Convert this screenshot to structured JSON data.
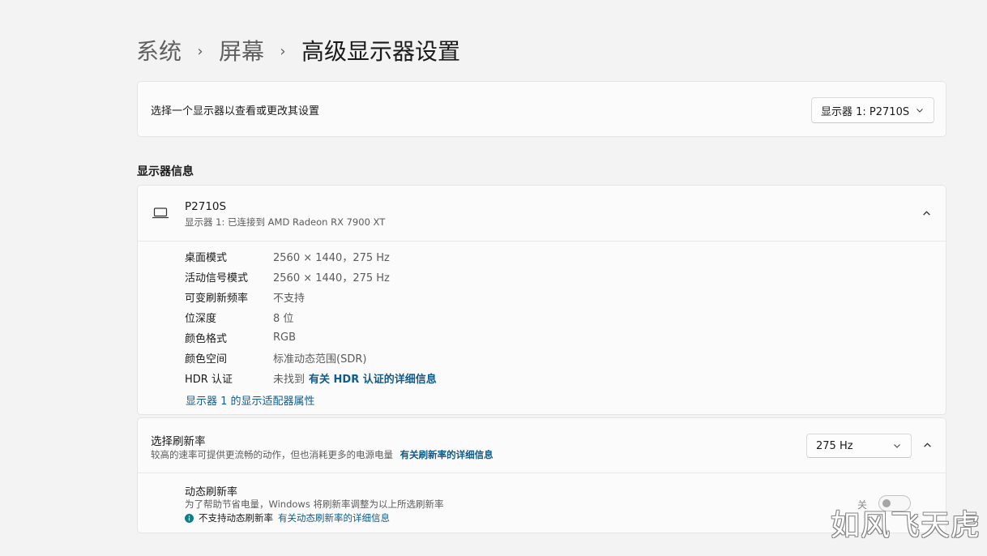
{
  "breadcrumb": {
    "items": [
      "系统",
      "屏幕",
      "高级显示器设置"
    ],
    "separator": "›"
  },
  "selector": {
    "label": "选择一个显示器以查看或更改其设置",
    "value": "显示器 1: P2710S"
  },
  "display_info": {
    "section_title": "显示器信息",
    "monitor_name": "P2710S",
    "monitor_subtitle": "显示器 1: 已连接到 AMD Radeon RX 7900 XT",
    "rows": [
      {
        "label": "桌面模式",
        "value": "2560 × 1440，275 Hz"
      },
      {
        "label": "活动信号模式",
        "value": "2560 × 1440，275 Hz"
      },
      {
        "label": "可变刷新频率",
        "value": "不支持"
      },
      {
        "label": "位深度",
        "value": "8 位"
      },
      {
        "label": "颜色格式",
        "value": "RGB"
      },
      {
        "label": "颜色空间",
        "value": "标准动态范围(SDR)"
      },
      {
        "label": "HDR 认证",
        "value": "未找到",
        "link": "有关 HDR 认证的详细信息"
      }
    ],
    "adapter_link": "显示器 1 的显示适配器属性"
  },
  "refresh_rate": {
    "title": "选择刷新率",
    "description": "较高的速率可提供更流畅的动作，但也消耗更多的电源电量",
    "link": "有关刷新率的详细信息",
    "value": "275 Hz"
  },
  "dynamic_refresh": {
    "title": "动态刷新率",
    "description": "为了帮助节省电量，Windows 将刷新率调整为以上所选刷新率",
    "status": "不支持动态刷新率",
    "link": "有关动态刷新率的详细信息",
    "toggle_state": "关",
    "enabled": false
  },
  "watermark": "如风飞天虎",
  "colors": {
    "accent": "#0f5b8a",
    "info_icon": "#0f7d86",
    "background": "#f3f3f3",
    "card": "#fbfbfb"
  },
  "icons": {
    "monitor": "laptop-icon",
    "chevron_down": "chevron-down-icon",
    "chevron_up": "chevron-up-icon",
    "info": "info-icon"
  }
}
